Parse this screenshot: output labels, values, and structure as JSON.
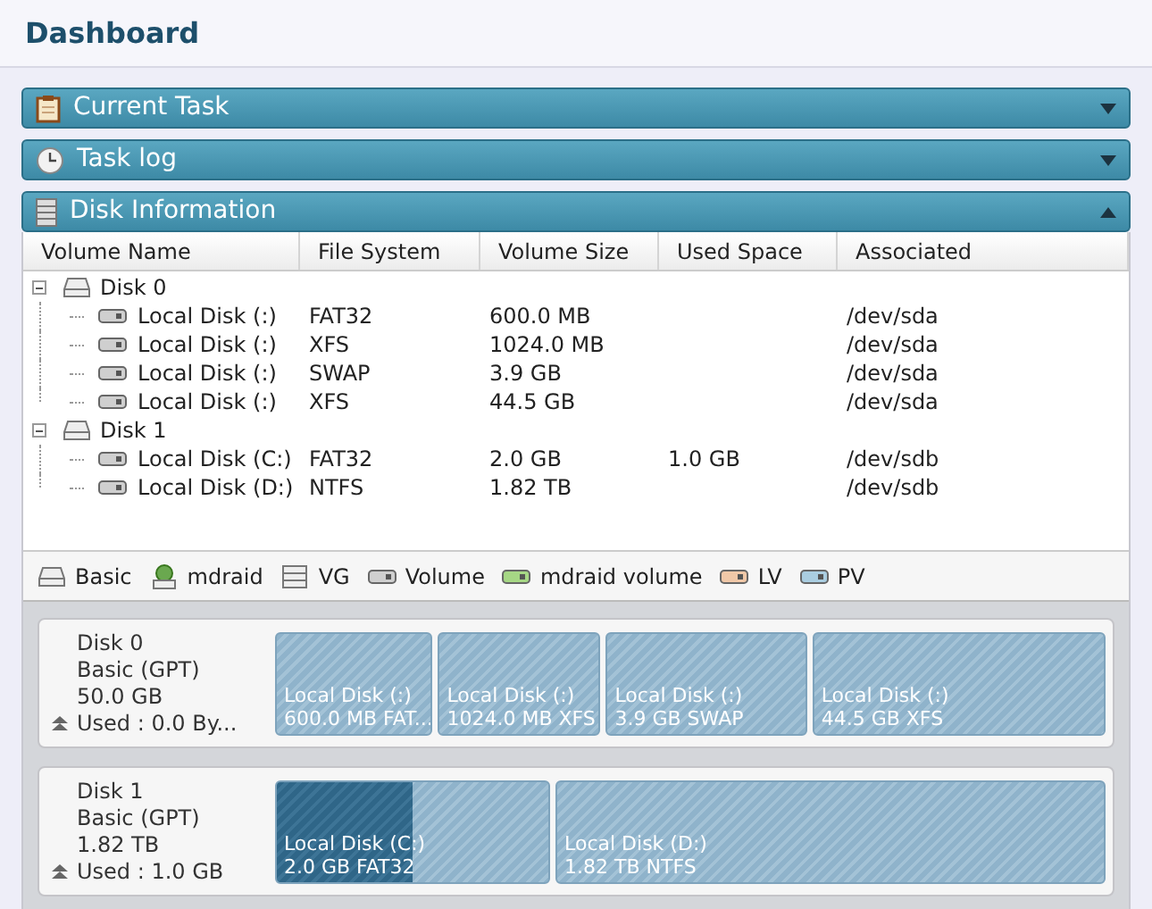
{
  "header": {
    "title": "Dashboard"
  },
  "panels": [
    {
      "title": "Current Task",
      "expanded": false
    },
    {
      "title": "Task log",
      "expanded": false
    },
    {
      "title": "Disk Information",
      "expanded": true
    }
  ],
  "table": {
    "columns": [
      "Volume Name",
      "File System",
      "Volume Size",
      "Used Space",
      "Associated"
    ],
    "rows": [
      {
        "name": "Disk 0",
        "expanded": true,
        "children": [
          {
            "name": "Local Disk (:)",
            "file_system": "FAT32",
            "size": "600.0 MB",
            "associated": "/dev/sda"
          },
          {
            "name": "Local Disk (:)",
            "file_system": "XFS",
            "size": "1024.0 MB",
            "associated": "/dev/sda"
          },
          {
            "name": "Local Disk (:)",
            "file_system": "SWAP",
            "size": "3.9 GB",
            "associated": "/dev/sda"
          },
          {
            "name": "Local Disk (:)",
            "file_system": "XFS",
            "size": "44.5 GB",
            "associated": "/dev/sda"
          }
        ]
      },
      {
        "name": "Disk 1",
        "expanded": true,
        "children": [
          {
            "name": "Local Disk (C:)",
            "file_system": "FAT32",
            "size": "2.0 GB",
            "used": "1.0 GB",
            "associated": "/dev/sdb"
          },
          {
            "name": "Local Disk (D:)",
            "file_system": "NTFS",
            "size": "1.82 TB",
            "associated": "/dev/sdb"
          }
        ]
      }
    ]
  },
  "legend": [
    {
      "label": "Basic",
      "kind": "basic"
    },
    {
      "label": "mdraid",
      "kind": "mdraid"
    },
    {
      "label": "VG",
      "kind": "vg"
    },
    {
      "label": "Volume",
      "kind": "volume"
    },
    {
      "label": "mdraid volume",
      "kind": "mdraid_volume"
    },
    {
      "label": "LV",
      "kind": "lv"
    },
    {
      "label": "PV",
      "kind": "pv"
    }
  ],
  "disks": [
    {
      "name": "Disk 0",
      "type": "Basic (GPT)",
      "size": "50.0 GB",
      "used": "Used : 0.0 By...",
      "partitions": [
        {
          "name": "Local Disk (:)",
          "detail": "600.0 MB FAT..."
        },
        {
          "name": "Local Disk (:)",
          "detail": "1024.0 MB XFS"
        },
        {
          "name": "Local Disk (:)",
          "detail": "3.9 GB SWAP"
        },
        {
          "name": "Local Disk (:)",
          "detail": "44.5 GB XFS"
        }
      ]
    },
    {
      "name": "Disk 1",
      "type": "Basic (GPT)",
      "size": "1.82 TB",
      "used": "Used : 1.0 GB",
      "partitions": [
        {
          "name": "Local Disk (C:)",
          "detail": "2.0 GB FAT32",
          "level": 0.5
        },
        {
          "name": "Local Disk (D:)",
          "detail": "1.82 TB NTFS"
        }
      ]
    }
  ]
}
